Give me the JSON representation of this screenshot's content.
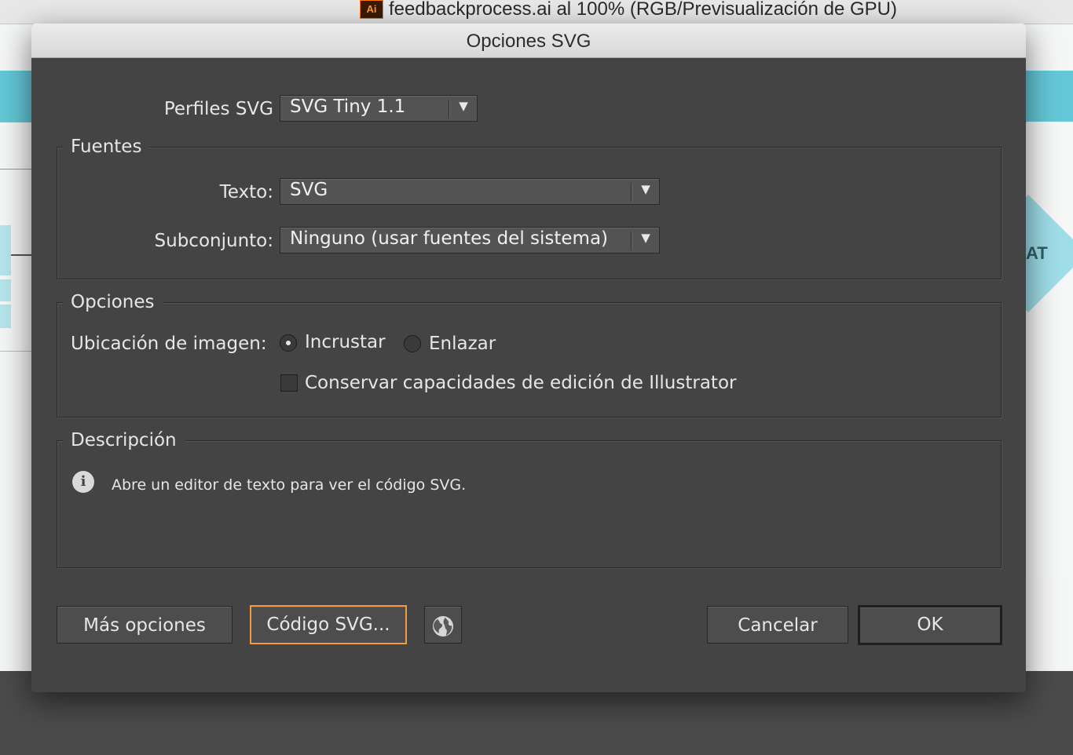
{
  "background_window": {
    "title": "feedbackprocess.ai al 100% (RGB/Previsualización de GPU)",
    "app_icon_label": "Ai",
    "partial_text": "AT"
  },
  "dialog": {
    "title": "Opciones SVG",
    "profiles": {
      "label": "Perfiles SVG",
      "value": "SVG Tiny 1.1"
    },
    "fonts": {
      "legend": "Fuentes",
      "text_label": "Texto:",
      "text_value": "SVG",
      "subset_label": "Subconjunto:",
      "subset_value": "Ninguno (usar fuentes del sistema)"
    },
    "options": {
      "legend": "Opciones",
      "image_location_label": "Ubicación de imagen:",
      "embed_label": "Incrustar",
      "embed_selected": true,
      "link_label": "Enlazar",
      "link_selected": false,
      "preserve_label": "Conservar capacidades de edición de Illustrator",
      "preserve_checked": false
    },
    "description": {
      "legend": "Descripción",
      "text": "Abre un editor de texto para ver el código SVG."
    },
    "buttons": {
      "more_options": "Más opciones",
      "svg_code": "Código SVG...",
      "cancel": "Cancelar",
      "ok": "OK"
    },
    "icons": {
      "info": "info-icon",
      "globe": "globe-icon",
      "dropdown": "chevron-down-icon"
    },
    "colors": {
      "focus_ring": "#f39a3c",
      "dialog_bg": "#444444",
      "accent_band": "#64c8d8"
    }
  }
}
